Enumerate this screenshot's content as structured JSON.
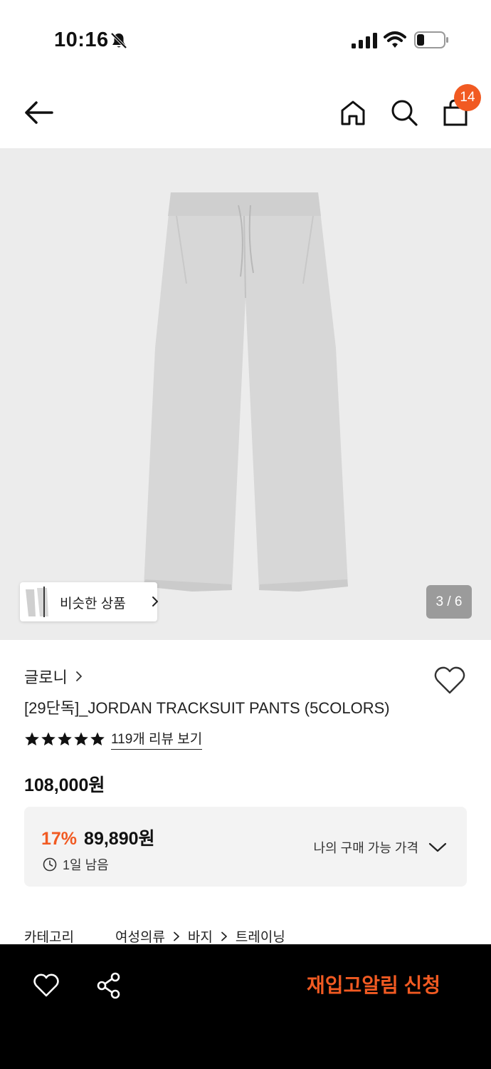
{
  "status_bar": {
    "time": "10:16"
  },
  "header": {
    "cart_count": "14",
    "icons": [
      "back-arrow-icon",
      "home-icon",
      "search-icon",
      "shopping-bag-icon"
    ]
  },
  "gallery": {
    "similar_label": "비슷한 상품",
    "page_indicator": "3 / 6"
  },
  "product": {
    "brand": "글로니",
    "title": "[29단독]_JORDAN TRACKSUIT PANTS (5COLORS)",
    "rating_stars": 5,
    "review_link": "119개 리뷰 보기",
    "price": "108,000원"
  },
  "discount": {
    "rate": "17%",
    "price": "89,890원",
    "time_left": "1일 남음",
    "my_price_label": "나의 구매 가능 가격"
  },
  "category": {
    "label": "카테고리",
    "path": [
      "여성의류",
      "바지",
      "트레이닝"
    ]
  },
  "bottom_bar": {
    "restock_label": "재입고알림 신청"
  },
  "colors": {
    "accent": "#f15a22",
    "bottom_bar_bg": "#000000",
    "hero_bg": "#ececec"
  }
}
